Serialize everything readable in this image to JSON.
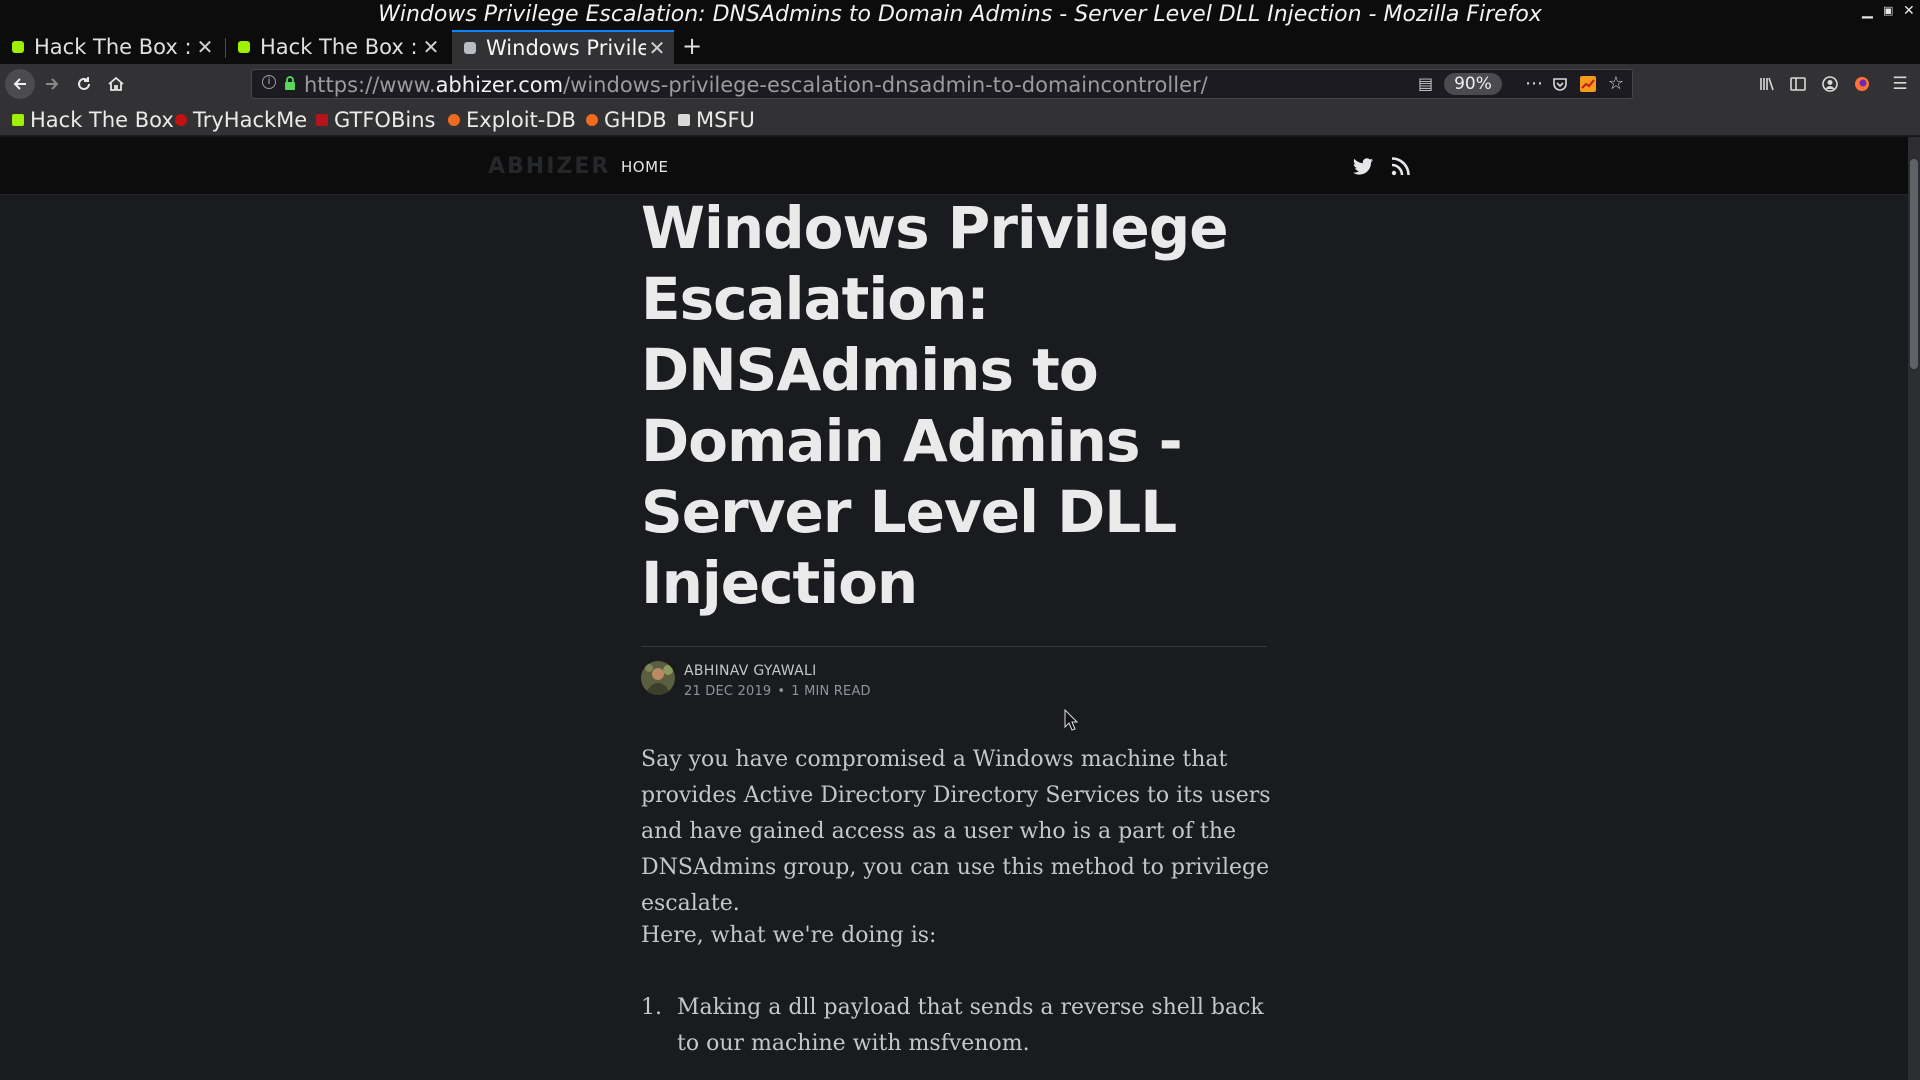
{
  "window": {
    "title": "Windows Privilege Escalation: DNSAdmins to Domain Admins - Server Level DLL Injection - Mozilla Firefox"
  },
  "tabs": [
    {
      "label": "Hack The Box :: M",
      "favicon_color": "#9fef00"
    },
    {
      "label": "Hack The Box :: R",
      "favicon_color": "#9fef00"
    },
    {
      "label": "Windows Privileg",
      "favicon_color": "#b9bcc2",
      "active": true
    }
  ],
  "navbar": {
    "url_scheme": "https://www.",
    "url_host": "abhizer.com",
    "url_path": "/windows-privilege-escalation-dnsadmin-to-domaincontroller/",
    "zoom": "90%"
  },
  "bookmarks": [
    {
      "label": "Hack The Box",
      "favicon_color": "#9fef00"
    },
    {
      "label": "TryHackMe",
      "favicon_color": "#c11111"
    },
    {
      "label": "GTFOBins",
      "favicon_color": "#b5141b"
    },
    {
      "label": "Exploit-DB",
      "favicon_color": "#f06b1d"
    },
    {
      "label": "GHDB",
      "favicon_color": "#f06b1d"
    },
    {
      "label": "MSFU",
      "favicon_color": "#d8d8d8"
    }
  ],
  "site": {
    "logo": "ABHIZER",
    "nav_home": "HOME"
  },
  "post": {
    "title": "Windows Privilege Escalation: DNSAdmins to Domain Admins - Server Level DLL Injection",
    "author": "ABHINAV GYAWALI",
    "date": "21 DEC 2019",
    "read_time": "1 MIN READ",
    "paragraph_1": "Say you have compromised a Windows machine that provides Active Directory Directory Services to its users and have gained access as a user who is a part of the DNSAdmins group, you can use this method to privilege escalate.",
    "paragraph_2": "Here, what we're doing is:",
    "list": [
      {
        "num": "1.",
        "text": "Making a dll payload that sends a reverse shell back to our machine with msfvenom."
      }
    ]
  },
  "colors": {
    "accent_tab": "#0a84ff",
    "page_bg": "#191b1f",
    "site_nav_bg": "#0c0c0d"
  }
}
